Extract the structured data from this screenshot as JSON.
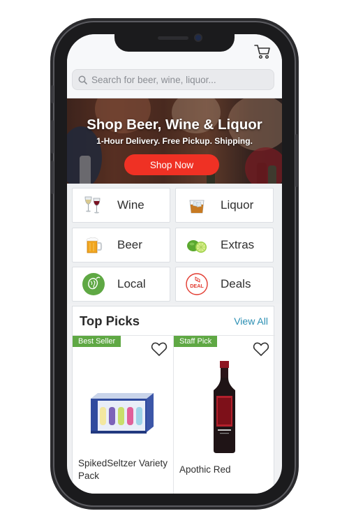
{
  "header": {
    "cart_icon": "cart-icon"
  },
  "search": {
    "placeholder": "Search for beer, wine, liquor..."
  },
  "hero": {
    "title": "Shop Beer, Wine & Liquor",
    "subtitle": "1-Hour Delivery. Free Pickup. Shipping.",
    "button_label": "Shop Now"
  },
  "categories": [
    {
      "label": "Wine",
      "icon": "wine-glass-icon"
    },
    {
      "label": "Liquor",
      "icon": "whiskey-glass-icon"
    },
    {
      "label": "Beer",
      "icon": "beer-mug-icon"
    },
    {
      "label": "Extras",
      "icon": "lime-icon"
    },
    {
      "label": "Local",
      "icon": "hops-icon"
    },
    {
      "label": "Deals",
      "icon": "deal-tag-icon"
    }
  ],
  "top_picks": {
    "title": "Top Picks",
    "view_all": "View All",
    "products": [
      {
        "badge": "Best Seller",
        "name": "SpikedSeltzer Variety Pack",
        "image": "variety-pack-box"
      },
      {
        "badge": "Staff Pick",
        "name": "Apothic Red",
        "image": "wine-bottle"
      }
    ]
  },
  "colors": {
    "accent": "#ef3124",
    "badge": "#5fa844",
    "link": "#2b8fb3"
  }
}
